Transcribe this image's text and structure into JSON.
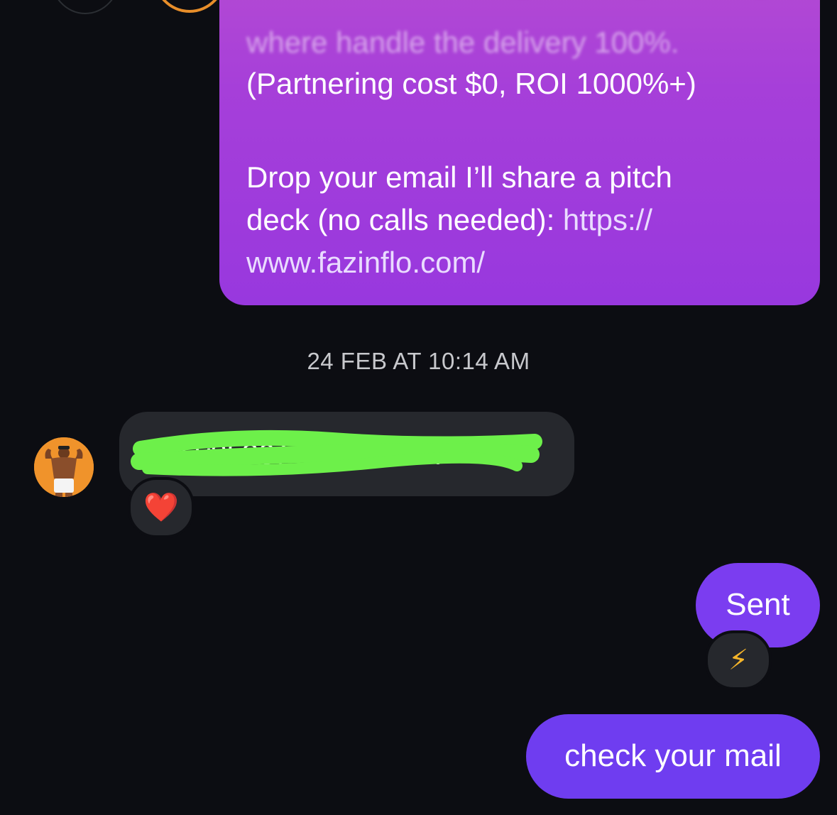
{
  "conversation": {
    "previous_message": {
      "blurred_line": "where handle the delivery 100%.",
      "line_1": "(Partnering cost $0, ROI 1000%+)",
      "line_2": "Drop your email I’ll share a pitch",
      "line_3_text": "deck (no calls needed): ",
      "link_part_1": "https://",
      "link_part_2": "www.fazinflo.com/"
    },
    "timestamp": "24 FEB AT 10:14 AM",
    "incoming_message": {
      "text": "g        t    l    y2k20@gmail.com",
      "reaction": "❤️"
    },
    "outgoing_messages": [
      {
        "text": "Sent",
        "reaction": "⚡"
      },
      {
        "text": "check your mail"
      }
    ]
  },
  "colors": {
    "background": "#0c0d12",
    "outgoing_bubble": "#7b3df0",
    "incoming_bubble": "#26282d",
    "redaction": "#6df04a"
  }
}
